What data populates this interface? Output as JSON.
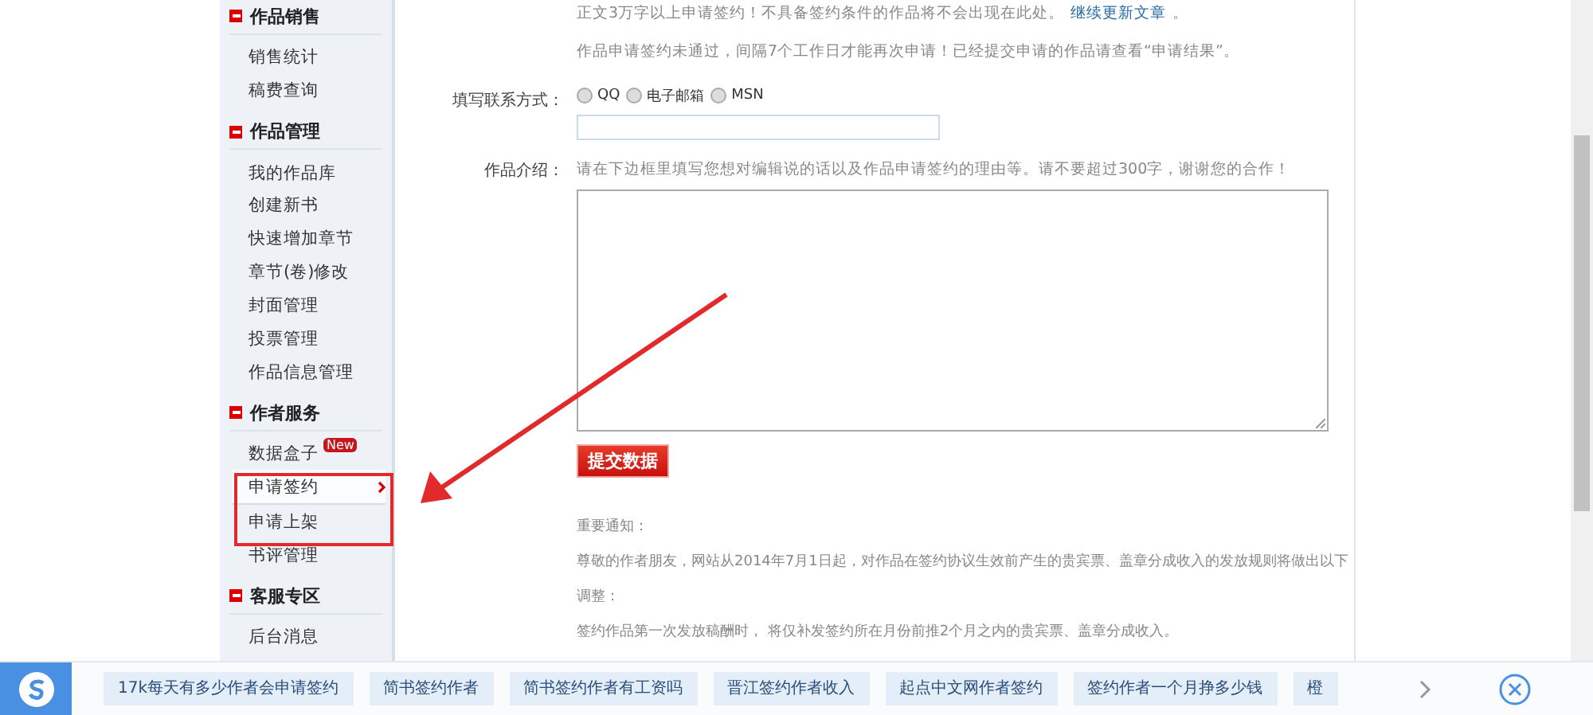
{
  "sidebar": {
    "sections": [
      {
        "title": "作品销售",
        "items": [
          {
            "label": "销售统计",
            "selected": false
          },
          {
            "label": "稿费查询",
            "selected": false
          }
        ]
      },
      {
        "title": "作品管理",
        "items": [
          {
            "label": "我的作品库",
            "selected": false
          },
          {
            "label": "创建新书",
            "selected": false
          },
          {
            "label": "快速增加章节",
            "selected": false
          },
          {
            "label": "章节(卷)修改",
            "selected": false
          },
          {
            "label": "封面管理",
            "selected": false
          },
          {
            "label": "投票管理",
            "selected": false
          },
          {
            "label": "作品信息管理",
            "selected": false
          }
        ]
      },
      {
        "title": "作者服务",
        "items": [
          {
            "label": "数据盒子",
            "selected": false,
            "badge": "New"
          },
          {
            "label": "申请签约",
            "selected": true
          },
          {
            "label": "申请上架",
            "selected": false
          },
          {
            "label": "书评管理",
            "selected": false
          }
        ]
      },
      {
        "title": "客服专区",
        "items": [
          {
            "label": "后台消息",
            "selected": false
          }
        ]
      }
    ]
  },
  "form": {
    "notes": [
      {
        "text": "正文3万字以上申请签约！不具备签约条件的作品将不会出现在此处。",
        "link": "继续更新文章",
        "after": "。"
      },
      {
        "text": "作品申请签约未通过，间隔7个工作日才能再次申请！已经提交申请的作品请查看“申请结果”。"
      }
    ],
    "contact": {
      "label": "填写联系方式：",
      "options": [
        {
          "label": "QQ",
          "selected": false
        },
        {
          "label": "电子邮箱",
          "selected": false
        },
        {
          "label": "MSN",
          "selected": false
        }
      ]
    },
    "intro": {
      "label": "作品介绍：",
      "hint": "请在下边框里填写您想对编辑说的话以及作品申请签约的理由等。请不要超过300字，谢谢您的合作！"
    },
    "submit": "提交数据",
    "notice": [
      "重要通知：",
      "尊敬的作者朋友，网站从2014年7月1日起，对作品在签约协议生效前产生的贵宾票、盖章分成收入的发放规则将做出以下",
      "调整：",
      "签约作品第一次发放稿酬时， 将仅补发签约所在月份前推2个月之内的贵宾票、盖章分成收入。"
    ]
  },
  "suggestions": [
    "17k每天有多少作者会申请签约",
    "简书签约作者",
    "简书签约作者有工资吗",
    "晋江签约作者收入",
    "起点中文网作者签约",
    "签约作者一个月挣多少钱",
    "橙"
  ]
}
